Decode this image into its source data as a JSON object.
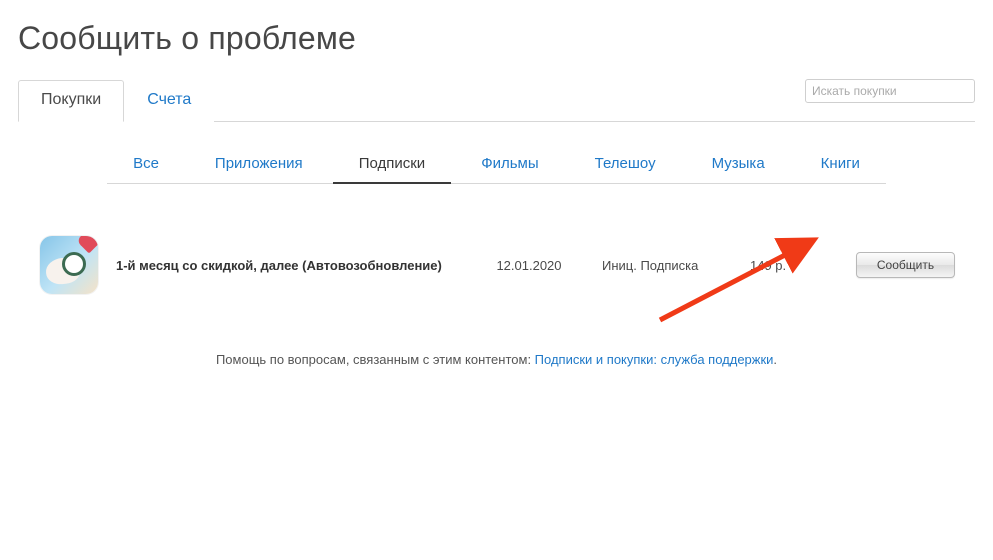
{
  "page": {
    "title": "Сообщить о проблеме"
  },
  "search": {
    "placeholder": "Искать покупки"
  },
  "main_tabs": [
    {
      "label": "Покупки",
      "active": true
    },
    {
      "label": "Счета",
      "active": false
    }
  ],
  "sub_tabs": [
    {
      "label": "Все",
      "active": false
    },
    {
      "label": "Приложения",
      "active": false
    },
    {
      "label": "Подписки",
      "active": true
    },
    {
      "label": "Фильмы",
      "active": false
    },
    {
      "label": "Телешоу",
      "active": false
    },
    {
      "label": "Музыка",
      "active": false
    },
    {
      "label": "Книги",
      "active": false
    }
  ],
  "items": [
    {
      "title": "1-й месяц со скидкой, далее (Автовозобновление)",
      "date": "12.01.2020",
      "status": "Иниц. Подписка",
      "price": "149 р.",
      "action_label": "Сообщить",
      "icon_name": "app-icon"
    }
  ],
  "help": {
    "prefix": "Помощь по вопросам, связанным с этим контентом: ",
    "link_text": "Подписки и покупки: служба поддержки",
    "suffix": "."
  },
  "annotation": {
    "arrow_color": "#f03a17"
  }
}
